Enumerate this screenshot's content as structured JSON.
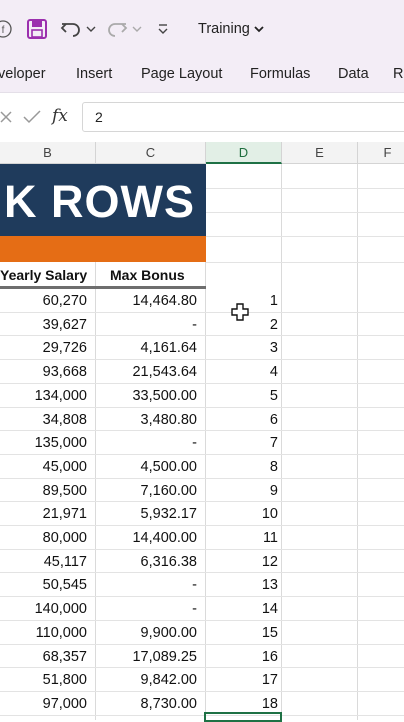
{
  "quick_access": {
    "workbook_name": "Training",
    "icons": [
      "save-icon",
      "undo-icon",
      "redo-icon",
      "customize-icon"
    ]
  },
  "ribbon": {
    "tabs": [
      "veloper",
      "Insert",
      "Page Layout",
      "Formulas",
      "Data",
      "R"
    ]
  },
  "formula_bar": {
    "fx_label": "fx",
    "value": "2"
  },
  "columns": [
    "B",
    "C",
    "D",
    "E",
    "F"
  ],
  "selected_column": "D",
  "sheet": {
    "banner_text": "K ROWS",
    "banner_color": "#1f3b5c",
    "accent_color": "#e56d15",
    "headers": {
      "b": "Yearly Salary",
      "c": "Max Bonus"
    },
    "rows": [
      {
        "salary": "60,270",
        "bonus": "14,464.80",
        "d": "1"
      },
      {
        "salary": "39,627",
        "bonus": "-",
        "d": "2"
      },
      {
        "salary": "29,726",
        "bonus": "4,161.64",
        "d": "3"
      },
      {
        "salary": "93,668",
        "bonus": "21,543.64",
        "d": "4"
      },
      {
        "salary": "134,000",
        "bonus": "33,500.00",
        "d": "5"
      },
      {
        "salary": "34,808",
        "bonus": "3,480.80",
        "d": "6"
      },
      {
        "salary": "135,000",
        "bonus": "-",
        "d": "7"
      },
      {
        "salary": "45,000",
        "bonus": "4,500.00",
        "d": "8"
      },
      {
        "salary": "89,500",
        "bonus": "7,160.00",
        "d": "9"
      },
      {
        "salary": "21,971",
        "bonus": "5,932.17",
        "d": "10"
      },
      {
        "salary": "80,000",
        "bonus": "14,400.00",
        "d": "11"
      },
      {
        "salary": "45,117",
        "bonus": "6,316.38",
        "d": "12"
      },
      {
        "salary": "50,545",
        "bonus": "-",
        "d": "13"
      },
      {
        "salary": "140,000",
        "bonus": "-",
        "d": "14"
      },
      {
        "salary": "110,000",
        "bonus": "9,900.00",
        "d": "15"
      },
      {
        "salary": "68,357",
        "bonus": "17,089.25",
        "d": "16"
      },
      {
        "salary": "51,800",
        "bonus": "9,842.00",
        "d": "17"
      },
      {
        "salary": "97,000",
        "bonus": "8,730.00",
        "d": "18"
      }
    ]
  }
}
